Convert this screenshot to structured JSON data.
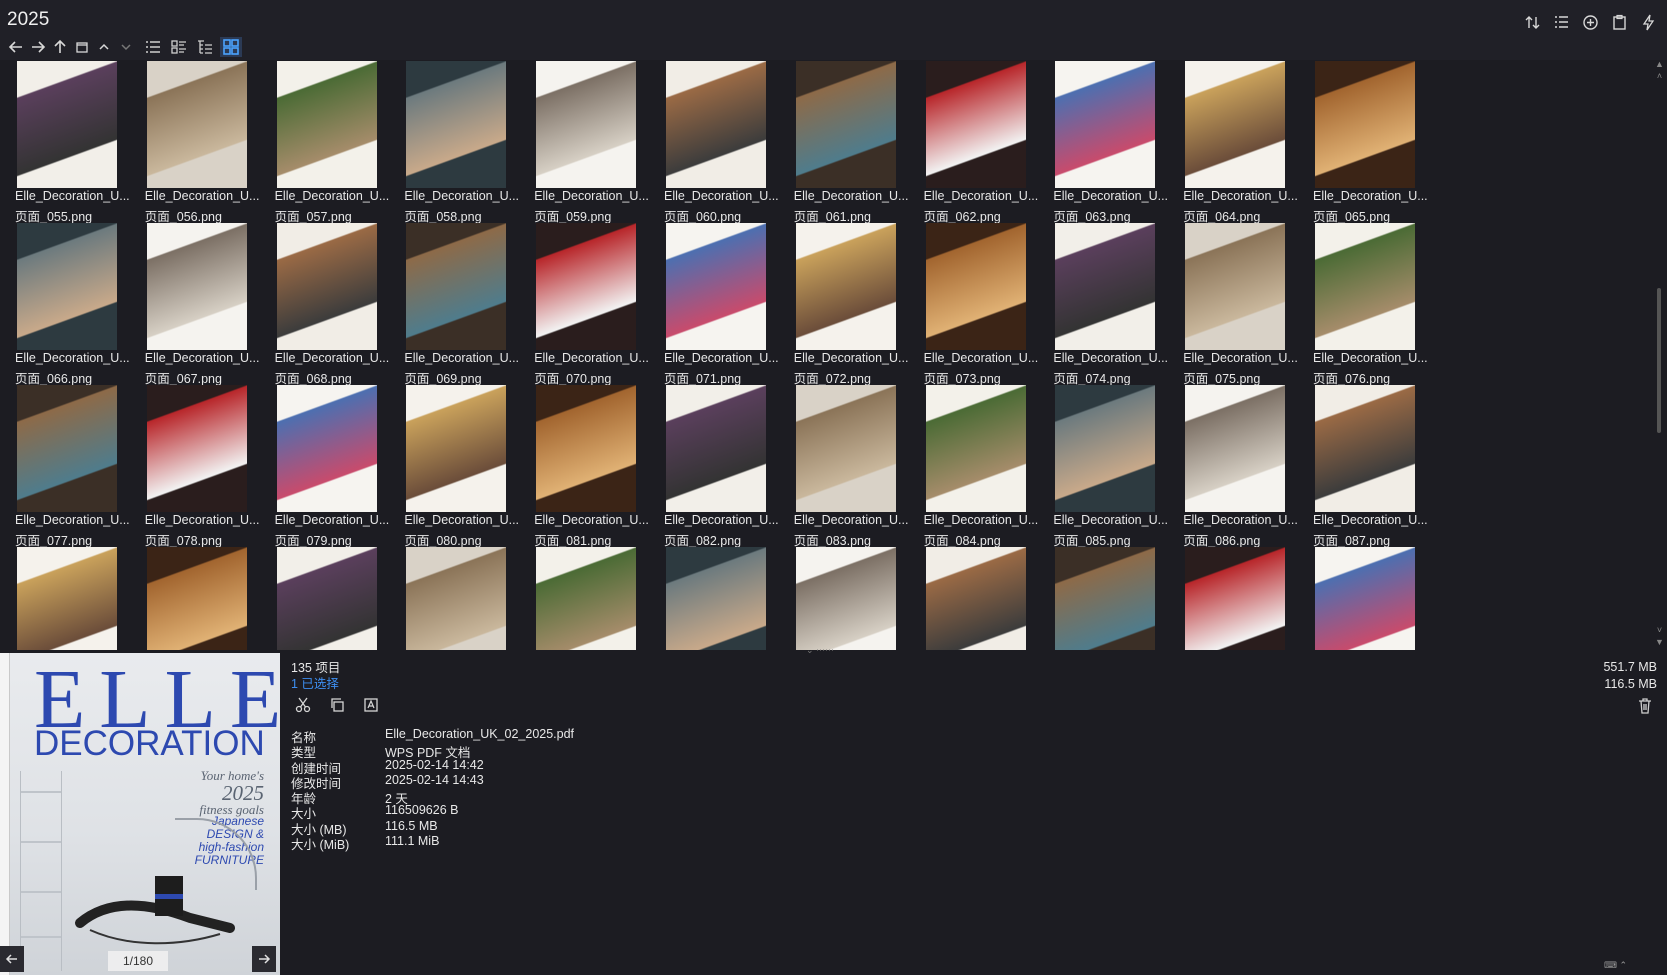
{
  "window": {
    "title": "2025"
  },
  "toolbar": {
    "nav": [
      "back-arrow",
      "forward-arrow",
      "up-arrow",
      "collapse-pane",
      "chevron-up",
      "chevron-down"
    ],
    "views": [
      "details-view",
      "list-view",
      "tree-view",
      "thumbnail-view"
    ],
    "active_view": "thumbnail-view",
    "right": [
      "sort-icon",
      "view-options-icon",
      "add-icon",
      "clipboard-icon",
      "lightning-icon"
    ]
  },
  "grid": {
    "rows": [
      [
        {
          "line1": "Elle_Decoration_U...",
          "line2": "页面_055.png"
        },
        {
          "line1": "Elle_Decoration_U...",
          "line2": "页面_056.png"
        },
        {
          "line1": "Elle_Decoration_U...",
          "line2": "页面_057.png"
        },
        {
          "line1": "Elle_Decoration_U...",
          "line2": "页面_058.png"
        },
        {
          "line1": "Elle_Decoration_U...",
          "line2": "页面_059.png"
        },
        {
          "line1": "Elle_Decoration_U...",
          "line2": "页面_060.png"
        },
        {
          "line1": "Elle_Decoration_U...",
          "line2": "页面_061.png"
        },
        {
          "line1": "Elle_Decoration_U...",
          "line2": "页面_062.png"
        },
        {
          "line1": "Elle_Decoration_U...",
          "line2": "页面_063.png"
        },
        {
          "line1": "Elle_Decoration_U...",
          "line2": "页面_064.png"
        },
        {
          "line1": "Elle_Decoration_U...",
          "line2": "页面_065.png"
        }
      ],
      [
        {
          "line1": "Elle_Decoration_U...",
          "line2": "页面_066.png"
        },
        {
          "line1": "Elle_Decoration_U...",
          "line2": "页面_067.png"
        },
        {
          "line1": "Elle_Decoration_U...",
          "line2": "页面_068.png"
        },
        {
          "line1": "Elle_Decoration_U...",
          "line2": "页面_069.png"
        },
        {
          "line1": "Elle_Decoration_U...",
          "line2": "页面_070.png"
        },
        {
          "line1": "Elle_Decoration_U...",
          "line2": "页面_071.png"
        },
        {
          "line1": "Elle_Decoration_U...",
          "line2": "页面_072.png"
        },
        {
          "line1": "Elle_Decoration_U...",
          "line2": "页面_073.png"
        },
        {
          "line1": "Elle_Decoration_U...",
          "line2": "页面_074.png"
        },
        {
          "line1": "Elle_Decoration_U...",
          "line2": "页面_075.png"
        },
        {
          "line1": "Elle_Decoration_U...",
          "line2": "页面_076.png"
        }
      ],
      [
        {
          "line1": "Elle_Decoration_U...",
          "line2": "页面_077.png"
        },
        {
          "line1": "Elle_Decoration_U...",
          "line2": "页面_078.png"
        },
        {
          "line1": "Elle_Decoration_U...",
          "line2": "页面_079.png"
        },
        {
          "line1": "Elle_Decoration_U...",
          "line2": "页面_080.png"
        },
        {
          "line1": "Elle_Decoration_U...",
          "line2": "页面_081.png"
        },
        {
          "line1": "Elle_Decoration_U...",
          "line2": "页面_082.png"
        },
        {
          "line1": "Elle_Decoration_U...",
          "line2": "页面_083.png"
        },
        {
          "line1": "Elle_Decoration_U...",
          "line2": "页面_084.png"
        },
        {
          "line1": "Elle_Decoration_U...",
          "line2": "页面_085.png"
        },
        {
          "line1": "Elle_Decoration_U...",
          "line2": "页面_086.png"
        },
        {
          "line1": "Elle_Decoration_U...",
          "line2": "页面_087.png"
        }
      ],
      [
        {
          "line1": "",
          "line2": ""
        },
        {
          "line1": "",
          "line2": ""
        },
        {
          "line1": "",
          "line2": ""
        },
        {
          "line1": "",
          "line2": ""
        },
        {
          "line1": "",
          "line2": ""
        },
        {
          "line1": "",
          "line2": ""
        },
        {
          "line1": "",
          "line2": ""
        },
        {
          "line1": "",
          "line2": ""
        },
        {
          "line1": "",
          "line2": ""
        },
        {
          "line1": "",
          "line2": ""
        },
        {
          "line1": "",
          "line2": ""
        }
      ]
    ]
  },
  "preview": {
    "cover_masthead": "ELLE",
    "cover_subtitle": "DECORATION",
    "cover_lines": [
      "Your home's",
      "2025",
      "fitness goals",
      "Japanese DESIGN & high-fashion FURNITURE"
    ],
    "page_indicator": "1/180"
  },
  "info": {
    "count": "135 项目",
    "selected": "1 已选择",
    "total_size": "551.7 MB",
    "selected_size": "116.5 MB",
    "properties": [
      {
        "key": "名称",
        "value": "Elle_Decoration_UK_02_2025.pdf"
      },
      {
        "key": "类型",
        "value": "WPS PDF 文档"
      },
      {
        "key": "创建时间",
        "value": "2025-02-14  14:42"
      },
      {
        "key": "修改时间",
        "value": "2025-02-14  14:43"
      },
      {
        "key": "年龄",
        "value": "2 天"
      },
      {
        "key": "大小",
        "value": "116509626 B"
      },
      {
        "key": "大小 (MB)",
        "value": "116.5 MB"
      },
      {
        "key": "大小 (MiB)",
        "value": "111.1 MiB"
      }
    ]
  },
  "colors": {
    "background": "#1c1c22",
    "accent": "#3d8ef0",
    "cover_blue": "#2d49b0"
  }
}
